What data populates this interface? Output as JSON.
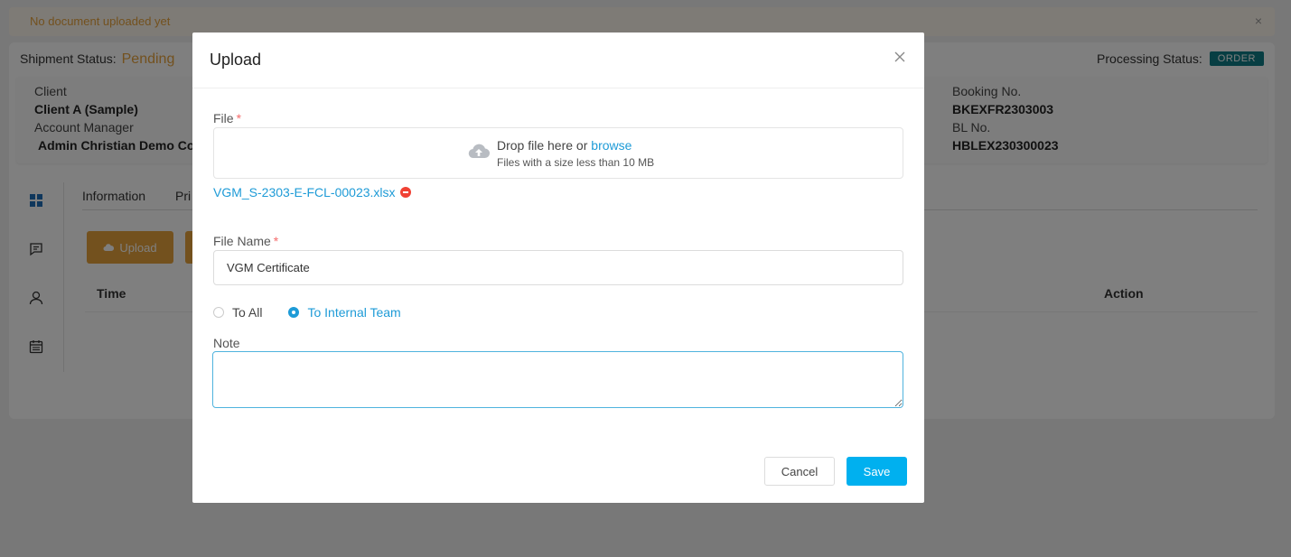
{
  "alert": {
    "text": "No document uploaded yet",
    "close": "×"
  },
  "shipment": {
    "label": "Shipment Status:",
    "value": "Pending"
  },
  "processing": {
    "label": "Processing Status:",
    "badge": "ORDER"
  },
  "info": {
    "client_label": "Client",
    "client_value": "Client A (Sample)",
    "manager_label": "Account Manager",
    "manager_value": "Admin Christian Demo Co",
    "booking_label": "Booking No.",
    "booking_value": "BKEXFR2303003",
    "bl_label": "BL No.",
    "bl_value": "HBLEX230300023"
  },
  "tabs": [
    {
      "label": "Information"
    },
    {
      "label": "Pri"
    }
  ],
  "toolbar": {
    "upload_label": "Upload"
  },
  "table": {
    "col_time": "Time",
    "col_action": "Action"
  },
  "modal": {
    "title": "Upload",
    "file_label": "File",
    "required_mark": "*",
    "dropzone_text": "Drop file here or",
    "dropzone_link": "browse",
    "dropzone_hint": "Files with a size less than 10 MB",
    "uploaded_file": "VGM_S-2303-E-FCL-00023.xlsx",
    "filename_label": "File Name",
    "filename_value": "VGM Certificate",
    "radio_all": "To All",
    "radio_internal": "To Internal Team",
    "note_label": "Note",
    "note_value": "",
    "cancel_label": "Cancel",
    "save_label": "Save"
  },
  "colors": {
    "accent": "#00b0ef",
    "warning": "#e6a23c",
    "badge": "#0e7c86",
    "link": "#1e9bd7"
  }
}
